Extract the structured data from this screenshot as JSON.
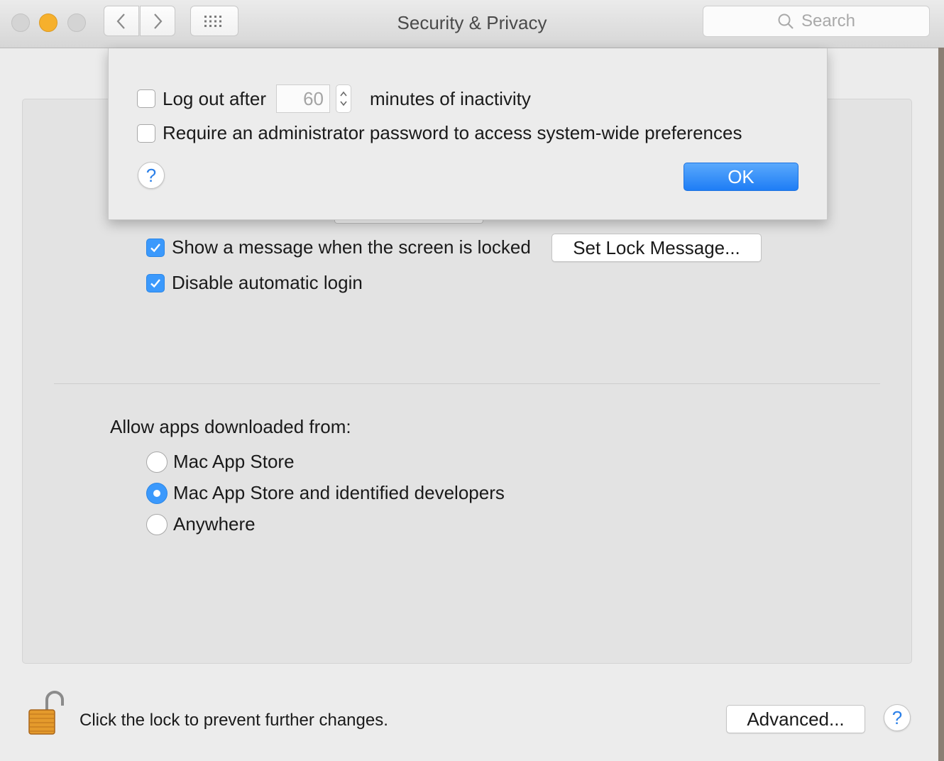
{
  "window": {
    "title": "Security & Privacy"
  },
  "toolbar": {
    "back_icon": "chevron-left-icon",
    "forward_icon": "chevron-right-icon",
    "grid_icon": "grid-icon"
  },
  "search": {
    "placeholder": "Search"
  },
  "sheet": {
    "logout_label": "Log out after",
    "logout_minutes": "60",
    "logout_suffix": "minutes of inactivity",
    "logout_checked": false,
    "admin_label": "Require an administrator password to access system-wide preferences",
    "admin_checked": false,
    "ok_label": "OK"
  },
  "general": {
    "show_message_label": "Show a message when the screen is locked",
    "show_message_checked": true,
    "set_lock_button": "Set Lock Message...",
    "disable_login_label": "Disable automatic login",
    "disable_login_checked": true
  },
  "gatekeeper": {
    "heading": "Allow apps downloaded from:",
    "options": [
      {
        "label": "Mac App Store",
        "selected": false
      },
      {
        "label": "Mac App Store and identified developers",
        "selected": true
      },
      {
        "label": "Anywhere",
        "selected": false
      }
    ]
  },
  "footer": {
    "lock_text": "Click the lock to prevent further changes.",
    "advanced_button": "Advanced...",
    "help_glyph": "?"
  },
  "colors": {
    "accent": "#3b99fc",
    "minimize": "#f6b02c"
  }
}
